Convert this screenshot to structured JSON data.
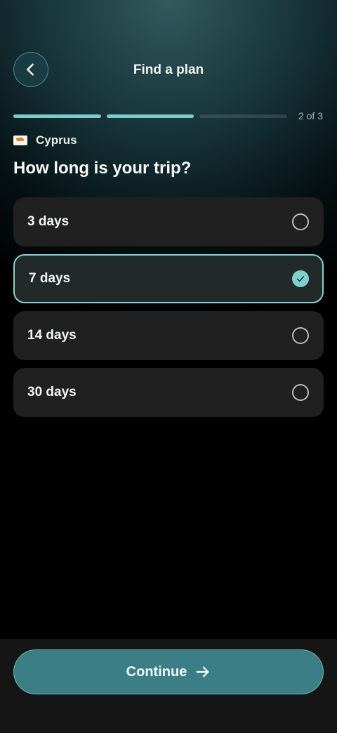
{
  "header": {
    "title": "Find a plan",
    "back_icon": "chevron-left-icon"
  },
  "progress": {
    "current": 2,
    "total": 3,
    "label": "2 of 3",
    "accent": "#7ccccc"
  },
  "country": {
    "flag_icon": "cyprus-flag-icon",
    "name": "Cyprus"
  },
  "question": "How long is your trip?",
  "options": [
    {
      "label": "3 days",
      "selected": false
    },
    {
      "label": "7 days",
      "selected": true
    },
    {
      "label": "14 days",
      "selected": false
    },
    {
      "label": "30 days",
      "selected": false
    }
  ],
  "footer": {
    "continue_label": "Continue",
    "continue_icon": "arrow-right-icon",
    "button_color": "#3b7e86"
  }
}
